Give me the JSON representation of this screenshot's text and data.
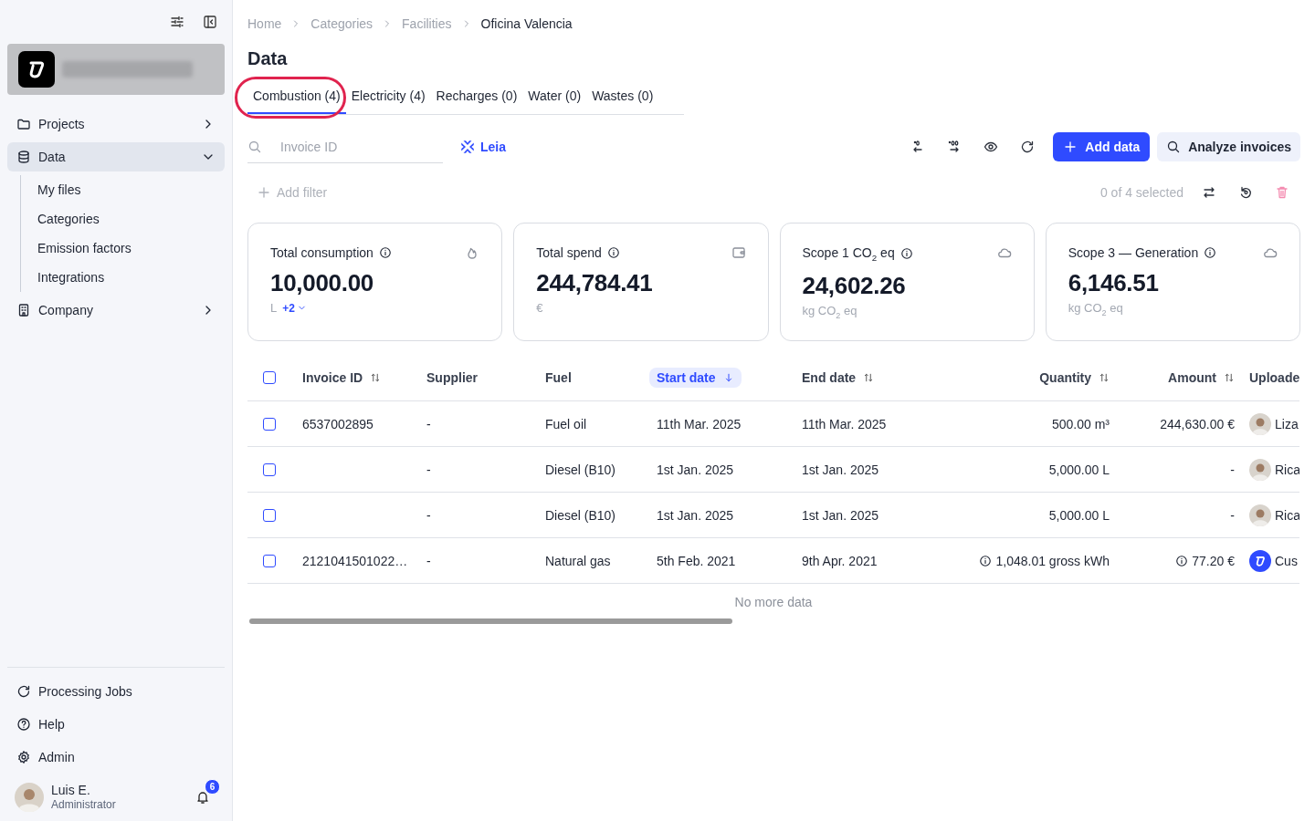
{
  "sidebar": {
    "nav": [
      {
        "label": "Projects",
        "expanded": false,
        "selected": false
      },
      {
        "label": "Data",
        "expanded": true,
        "selected": true,
        "children": [
          {
            "label": "My files"
          },
          {
            "label": "Categories"
          },
          {
            "label": "Emission factors"
          },
          {
            "label": "Integrations"
          }
        ]
      },
      {
        "label": "Company",
        "expanded": false,
        "selected": false
      }
    ],
    "bottom": [
      {
        "label": "Processing Jobs"
      },
      {
        "label": "Help"
      },
      {
        "label": "Admin"
      }
    ],
    "user": {
      "name": "Luis E.",
      "role": "Administrator",
      "notifications": "6"
    }
  },
  "breadcrumb": [
    {
      "label": "Home",
      "current": false
    },
    {
      "label": "Categories",
      "current": false
    },
    {
      "label": "Facilities",
      "current": false
    },
    {
      "label": "Oficina Valencia",
      "current": true
    }
  ],
  "title": "Data",
  "tabs": [
    {
      "label": "Combustion (4)",
      "selected": true,
      "circled": true
    },
    {
      "label": "Electricity (4)",
      "selected": false,
      "circled": false
    },
    {
      "label": "Recharges (0)",
      "selected": false,
      "circled": false
    },
    {
      "label": "Water (0)",
      "selected": false,
      "circled": false
    },
    {
      "label": "Wastes (0)",
      "selected": false,
      "circled": false
    }
  ],
  "search": {
    "placeholder": "Invoice ID"
  },
  "assistant_link": "Leia",
  "buttons": [
    {
      "label": "Add data",
      "kind": "primary"
    },
    {
      "label": "Analyze invoices",
      "kind": "secondary"
    }
  ],
  "add_filter": "Add filter",
  "selection_count": "0 of 4 selected",
  "cards": [
    {
      "title": "Total consumption",
      "value": "10,000.00",
      "unit": "L",
      "extra": "+2"
    },
    {
      "title": "Total spend",
      "value": "244,784.41",
      "unit": "€"
    },
    {
      "title": "Scope 1 CO$_{2}$ eq",
      "value": "24,602.26",
      "unit": "kg CO$_{2}$ eq"
    },
    {
      "title": "Scope 3 — Generation",
      "value": "6,146.51",
      "unit": "kg CO$_{2}$ eq"
    }
  ],
  "table": {
    "all_checked": false,
    "columns": [
      {
        "label": "Invoice ID",
        "sortable": true,
        "sorted": false
      },
      {
        "label": "Supplier",
        "sortable": false,
        "sorted": false
      },
      {
        "label": "Fuel",
        "sortable": false,
        "sorted": false
      },
      {
        "label": "Start date",
        "sortable": true,
        "sorted": true
      },
      {
        "label": "End date",
        "sortable": true,
        "sorted": false
      },
      {
        "label": "Quantity",
        "sortable": true,
        "sorted": false
      },
      {
        "label": "Amount",
        "sortable": true,
        "sorted": false
      },
      {
        "label": "Uploade",
        "sortable": false,
        "sorted": false
      }
    ],
    "rows": [
      {
        "checked": false,
        "invoice_id": "6537002895",
        "supplier": "-",
        "fuel": "Fuel oil",
        "start_date": "11th Mar. 2025",
        "end_date": "11th Mar. 2025",
        "quantity": "500.00 m³",
        "quantity_info": false,
        "amount": "244,630.00 €",
        "amount_info": false,
        "uploader": "Liza",
        "company_avatar": false
      },
      {
        "checked": false,
        "supplier": "-",
        "fuel": "Diesel (B10)",
        "start_date": "1st Jan. 2025",
        "end_date": "1st Jan. 2025",
        "quantity": "5,000.00 L",
        "quantity_info": false,
        "amount": "-",
        "amount_info": false,
        "uploader": "Rica",
        "company_avatar": false
      },
      {
        "checked": false,
        "supplier": "-",
        "fuel": "Diesel (B10)",
        "start_date": "1st Jan. 2025",
        "end_date": "1st Jan. 2025",
        "quantity": "5,000.00 L",
        "quantity_info": false,
        "amount": "-",
        "amount_info": false,
        "uploader": "Rica",
        "company_avatar": false
      },
      {
        "checked": false,
        "invoice_id": "2121041501022…",
        "supplier": "-",
        "fuel": "Natural gas",
        "start_date": "5th Feb. 2021",
        "end_date": "9th Apr. 2021",
        "quantity": "1,048.01 gross kWh",
        "quantity_info": true,
        "amount": "77.20 €",
        "amount_info": true,
        "uploader": "Cus",
        "company_avatar": true
      }
    ],
    "footer": "No more data"
  }
}
